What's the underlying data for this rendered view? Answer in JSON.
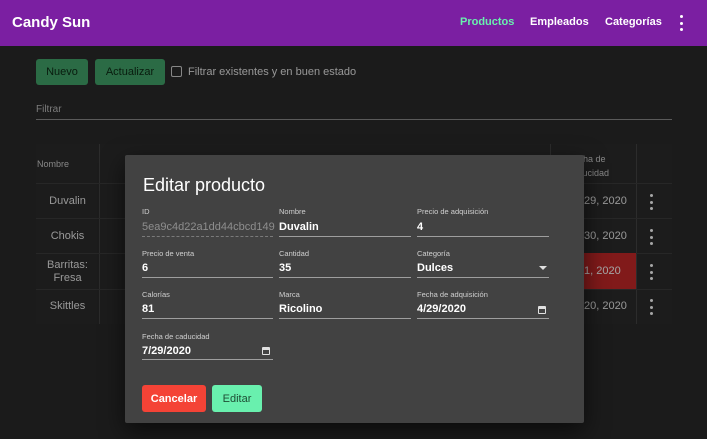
{
  "app": {
    "brand": "Candy Sun",
    "nav": [
      "Productos",
      "Empleados",
      "Categorías"
    ],
    "menu_icon": "more-vert-icon"
  },
  "toolbar": {
    "new_label": "Nuevo",
    "refresh_label": "Actualizar",
    "filter_checkbox_label": "Filtrar existentes y en buen estado",
    "filter_checked": false
  },
  "filter": {
    "placeholder": "Filtrar"
  },
  "table": {
    "headers": [
      "Nombre",
      "Fecha de caducidad"
    ],
    "rows": [
      {
        "name": "Duvalin",
        "expiry": "29, 2020",
        "expired": false
      },
      {
        "name": "Chokis",
        "expiry": "30, 2020",
        "expired": false
      },
      {
        "name": "Barritas: Fresa",
        "expiry": "1, 2020",
        "expired": true
      },
      {
        "name": "Skittles",
        "expiry": "20, 2020",
        "expired": false
      }
    ]
  },
  "dialog": {
    "title": "Editar producto",
    "fields": {
      "id": {
        "label": "ID",
        "value": "5ea9c4d22a1dd44cbcd149c"
      },
      "nombre": {
        "label": "Nombre",
        "value": "Duvalin"
      },
      "precio_adq": {
        "label": "Precio de adquisición",
        "value": "4"
      },
      "precio_venta": {
        "label": "Precio de venta",
        "value": "6"
      },
      "cantidad": {
        "label": "Cantidad",
        "value": "35"
      },
      "categoria": {
        "label": "Categoría",
        "value": "Dulces"
      },
      "calorias": {
        "label": "Calorías",
        "value": "81"
      },
      "marca": {
        "label": "Marca",
        "value": "Ricolino"
      },
      "fecha_adq": {
        "label": "Fecha de adquisición",
        "value": "4/29/2020"
      },
      "fecha_cad": {
        "label": "Fecha de caducidad",
        "value": "7/29/2020"
      }
    },
    "cancel_label": "Cancelar",
    "save_label": "Editar"
  },
  "colors": {
    "appbar": "#7b1fa2",
    "accent": "#69f0ae",
    "danger": "#f44336",
    "primary_button": "#43a56a"
  }
}
